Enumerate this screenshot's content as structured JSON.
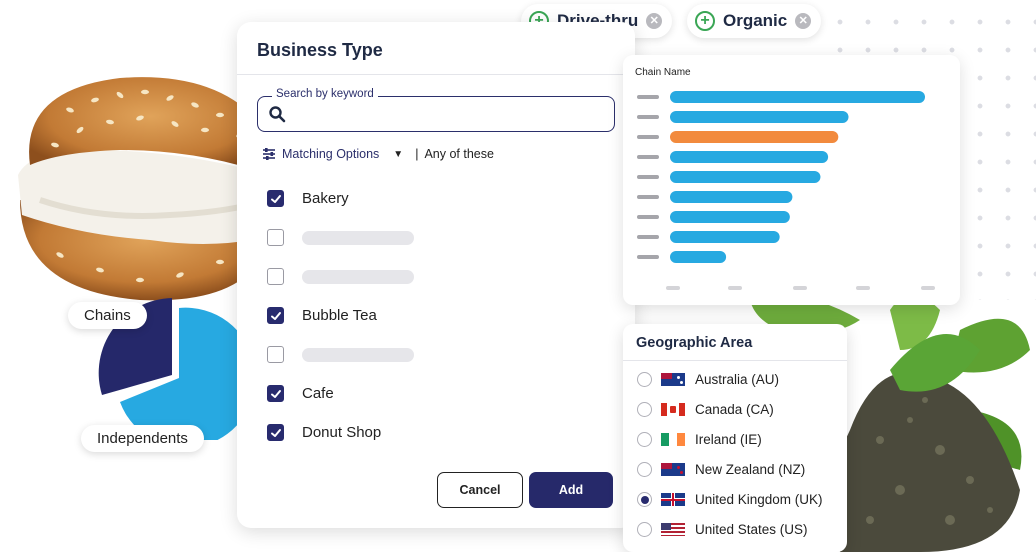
{
  "chips": [
    {
      "label": "Drive-thru"
    },
    {
      "label": "Organic"
    }
  ],
  "business_type": {
    "title": "Business Type",
    "search": {
      "legend": "Search by keyword",
      "value": "",
      "placeholder": ""
    },
    "matching": {
      "label": "Matching Options",
      "separator": "|",
      "mode": "Any of these"
    },
    "options": [
      {
        "label": "Bakery",
        "checked": true
      },
      {
        "label": "",
        "checked": false
      },
      {
        "label": "",
        "checked": false
      },
      {
        "label": "Bubble Tea",
        "checked": true
      },
      {
        "label": "",
        "checked": false
      },
      {
        "label": "Cafe",
        "checked": true
      },
      {
        "label": "Donut Shop",
        "checked": true
      }
    ],
    "cancel_label": "Cancel",
    "add_label": "Add"
  },
  "pie": {
    "chains_label": "Chains",
    "independents_label": "Independents",
    "colors": {
      "chains": "#25286a",
      "independents": "#27a9e1"
    }
  },
  "chart": {
    "title": "Chain Name",
    "colors": {
      "bar": "#27a9e1",
      "highlight": "#f28a3d",
      "placeholder": "#a5a5aa"
    }
  },
  "chart_data": {
    "type": "bar",
    "orientation": "horizontal",
    "title": "Chain Name",
    "categories": [
      "",
      "",
      "",
      "",
      "",
      "",
      "",
      "",
      ""
    ],
    "values": [
      100,
      70,
      66,
      62,
      59,
      48,
      47,
      43,
      22
    ],
    "highlight_index": 2,
    "xlim": [
      0,
      100
    ]
  },
  "geo": {
    "title": "Geographic Area",
    "options": [
      {
        "label": "Australia (AU)",
        "flag": "au",
        "selected": false
      },
      {
        "label": "Canada (CA)",
        "flag": "ca",
        "selected": false
      },
      {
        "label": "Ireland (IE)",
        "flag": "ie",
        "selected": false
      },
      {
        "label": "New Zealand (NZ)",
        "flag": "nz",
        "selected": false
      },
      {
        "label": "United Kingdom (UK)",
        "flag": "uk",
        "selected": true
      },
      {
        "label": "United States (US)",
        "flag": "us",
        "selected": false
      }
    ]
  },
  "icons": {
    "chip_add": "plus-circle-icon",
    "chip_remove": "close-circle-icon",
    "search": "magnifier-icon",
    "matching": "sliders-icon",
    "checkbox": "check-icon"
  }
}
